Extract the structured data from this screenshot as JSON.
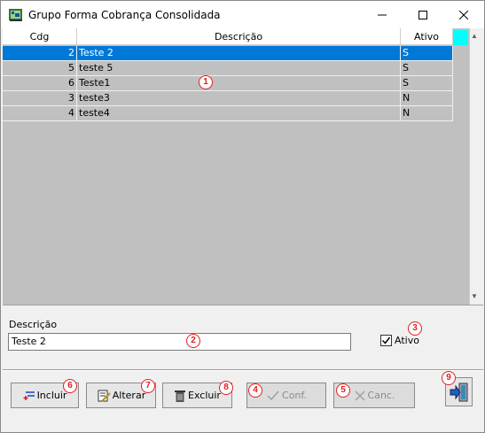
{
  "window": {
    "title": "Grupo Forma Cobrança Consolidada",
    "accent": "#0078d7"
  },
  "grid": {
    "columns": [
      "Cdg",
      "Descrição",
      "Ativo"
    ],
    "rows": [
      {
        "cdg": "2",
        "descricao": "Teste 2",
        "ativo": "S",
        "selected": true
      },
      {
        "cdg": "5",
        "descricao": "teste 5",
        "ativo": "S",
        "selected": false
      },
      {
        "cdg": "6",
        "descricao": "Teste1",
        "ativo": "S",
        "selected": false
      },
      {
        "cdg": "3",
        "descricao": "teste3",
        "ativo": "N",
        "selected": false
      },
      {
        "cdg": "4",
        "descricao": "teste4",
        "ativo": "N",
        "selected": false
      }
    ]
  },
  "form": {
    "descricao_label": "Descrição",
    "descricao_value": "Teste 2",
    "ativo_label": "Ativo",
    "ativo_checked": true
  },
  "buttons": {
    "incluir": "Incluir",
    "alterar": "Alterar",
    "excluir": "Excluir",
    "conf": "Conf.",
    "canc": "Canc."
  },
  "badges": [
    "1",
    "2",
    "3",
    "4",
    "5",
    "6",
    "7",
    "8",
    "9"
  ]
}
